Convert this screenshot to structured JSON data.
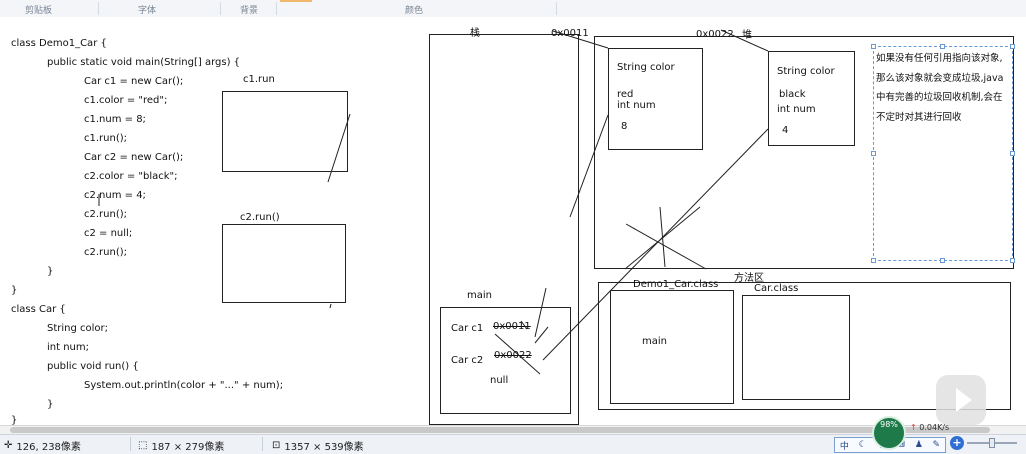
{
  "ribbon": {
    "groups": [
      "剪贴板",
      "字体",
      "背景",
      "颜色"
    ]
  },
  "code": {
    "lines": [
      "class Demo1_Car {",
      "public static void main(String[] args) {",
      "Car c1 = new Car();",
      "c1.color = \"red\";",
      "c1.num = 8;",
      "c1.run();",
      "Car c2 = new Car();",
      "c2.color = \"black\";",
      "c2.num = 4;",
      "c2.run();",
      "c2 = null;",
      "c2.run();",
      "}",
      "}",
      "class Car {",
      "String color;",
      "int num;",
      "public void run() {",
      "System.out.println(color + \"...\" + num);",
      "}",
      "}"
    ]
  },
  "frames": {
    "c1_run": "c1.run",
    "c2_run": "c2.run()"
  },
  "stack": {
    "title": "栈",
    "main_label": "main",
    "c1_label": "Car c1",
    "c1_ref": "0x0011",
    "c2_label": "Car c2",
    "c2_ref": "0x0022",
    "null_label": "null"
  },
  "heap": {
    "title": "堆",
    "addr1": "0x0011",
    "addr2": "0x0022",
    "obj1": {
      "field1": "String color",
      "val1": "red",
      "field2": "int num",
      "val2": "8"
    },
    "obj2": {
      "field1": "String color",
      "val1": "black",
      "field2": "int num",
      "val2": "4"
    },
    "note": "如果没有任何引用指向该对象,那么该对象就会变成垃圾,java中有完善的垃圾回收机制,会在不定时对其进行回收"
  },
  "method_area": {
    "title": "方法区",
    "class1": "Demo1_Car.class",
    "class1_inner": "main",
    "class2": "Car.class"
  },
  "statusbar": {
    "cursor": "126, 238像素",
    "selection": "187 × 279像素",
    "image_size": "1357 × 539像素"
  },
  "tray": {
    "badge": "98%",
    "speed": "0.04K/s",
    "ime_mode": "中"
  }
}
